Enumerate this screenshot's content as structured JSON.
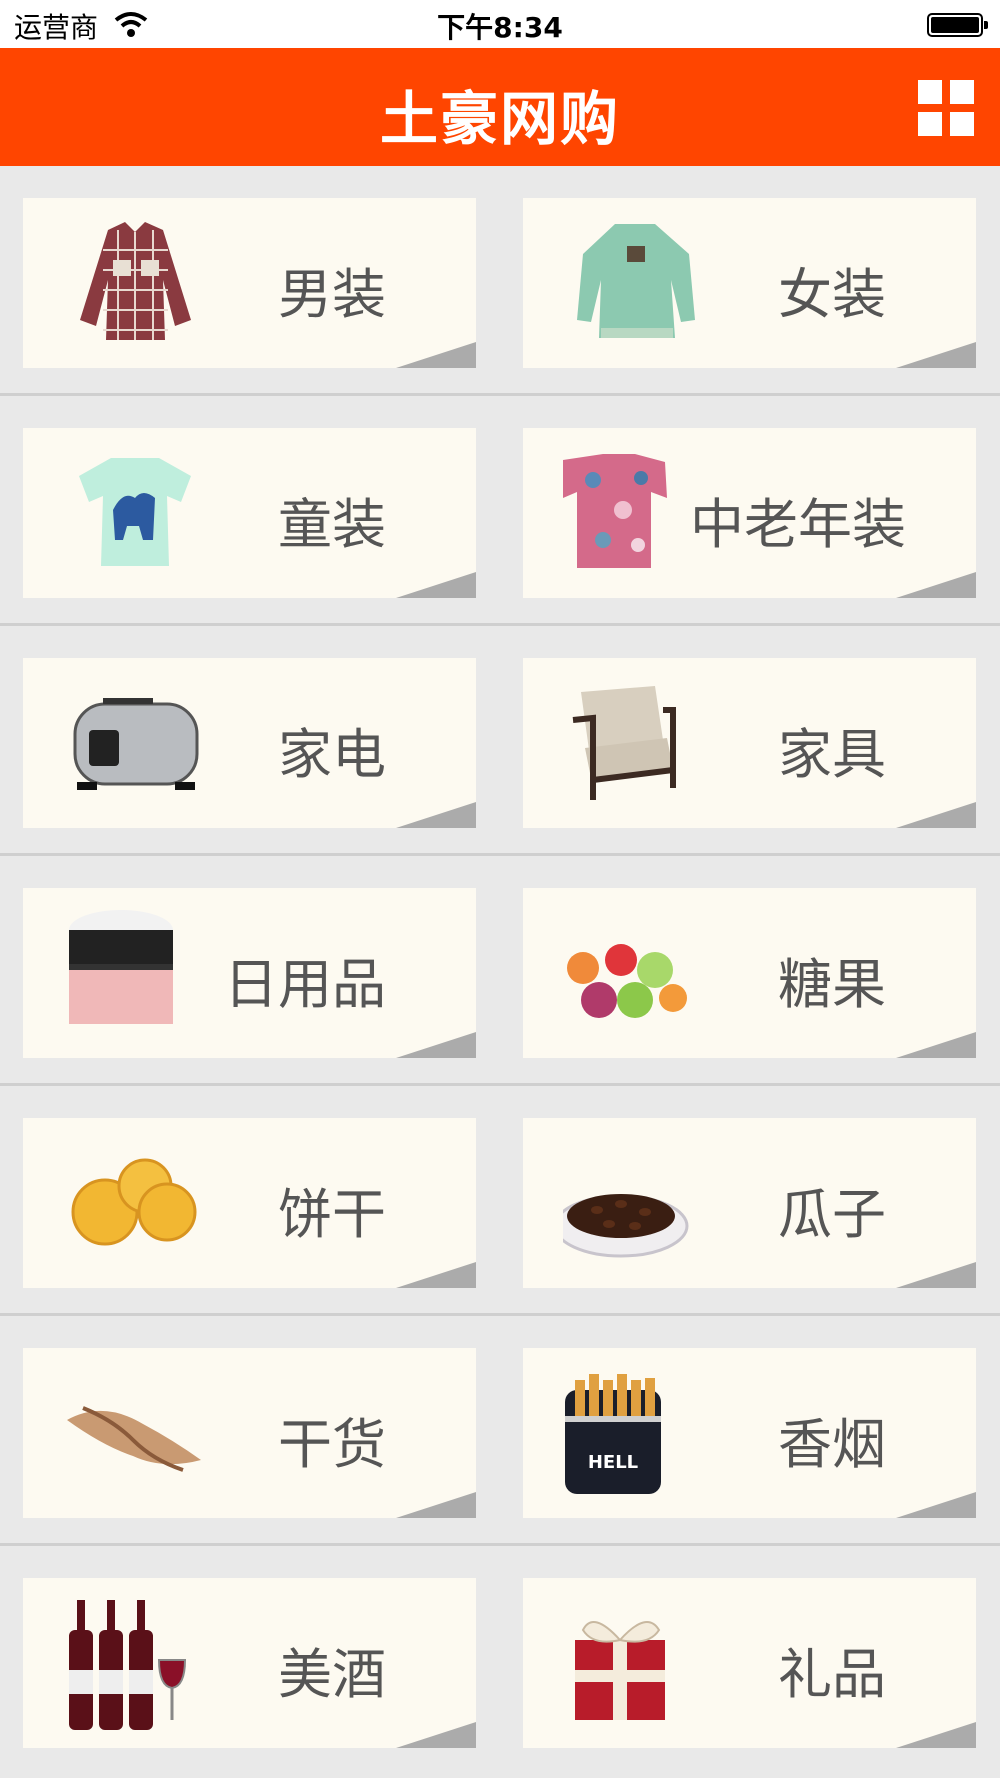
{
  "status_bar": {
    "carrier": "运营商",
    "time": "下午8:34"
  },
  "header": {
    "title": "土豪网购"
  },
  "categories": [
    {
      "label": "男装",
      "icon": "shirt-icon"
    },
    {
      "label": "女装",
      "icon": "womens-top-icon"
    },
    {
      "label": "童装",
      "icon": "kids-tshirt-icon"
    },
    {
      "label": "中老年装",
      "icon": "floral-blouse-icon"
    },
    {
      "label": "家电",
      "icon": "toaster-icon"
    },
    {
      "label": "家具",
      "icon": "armchair-icon"
    },
    {
      "label": "日用品",
      "icon": "cosmetic-jar-icon"
    },
    {
      "label": "糖果",
      "icon": "gummy-candy-icon"
    },
    {
      "label": "饼干",
      "icon": "biscuit-icon"
    },
    {
      "label": "瓜子",
      "icon": "seeds-plate-icon"
    },
    {
      "label": "干货",
      "icon": "dried-fish-icon"
    },
    {
      "label": "香烟",
      "icon": "cigarette-pack-icon"
    },
    {
      "label": "美酒",
      "icon": "wine-bottles-icon"
    },
    {
      "label": "礼品",
      "icon": "gift-box-icon"
    }
  ],
  "colors": {
    "header": "#ff4500",
    "card": "#fdfaf1",
    "background": "#e9e9e9",
    "label": "#555555"
  }
}
